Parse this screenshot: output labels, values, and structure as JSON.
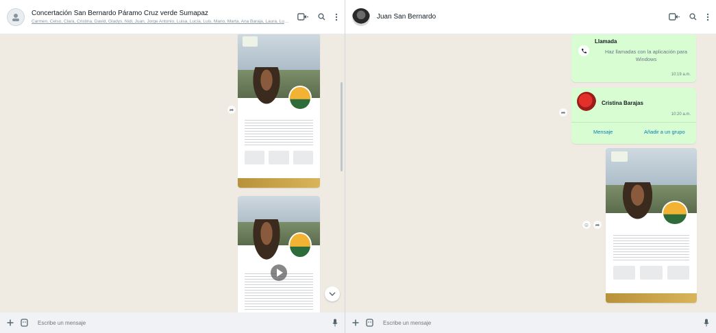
{
  "left_chat": {
    "title": "Concertación San Bernardo Páramo Cruz verde Sumapaz",
    "participants": "Carmen, Celso, Clara, Cristina, David, Gladys, Nidi, Juan, Jorge Antonio, Luisa, Lucía, Luis, Mario, Marta, Ana Baraja, Laura, Luisa, Luis...",
    "composer_placeholder": "Escribe un mensaje"
  },
  "right_chat": {
    "title": "Juan San Bernardo",
    "call_message": {
      "title": "Llamada",
      "description": "Haz llamadas con la aplicación para Windows",
      "time": "10:19 a.m."
    },
    "contact_card": {
      "name": "Cristina Barajas",
      "time": "10:20 a.m.",
      "action_message": "Mensaje",
      "action_add_group": "Añadir a un grupo"
    },
    "composer_placeholder": "Escribe un mensaje"
  },
  "icons": {
    "video": "video-call-icon",
    "search": "search-icon",
    "menu": "menu-icon",
    "attach": "plus-icon",
    "sticker": "sticker-icon",
    "mic": "mic-icon",
    "forward": "forward-icon",
    "scroll_down": "chevron-down-icon",
    "call": "phone-icon"
  },
  "colors": {
    "chat_background": "#efeae2",
    "outgoing_bubble": "#d9fdd3",
    "header": "#ffffff",
    "composer": "#f0f2f5",
    "link": "#027eb5"
  }
}
